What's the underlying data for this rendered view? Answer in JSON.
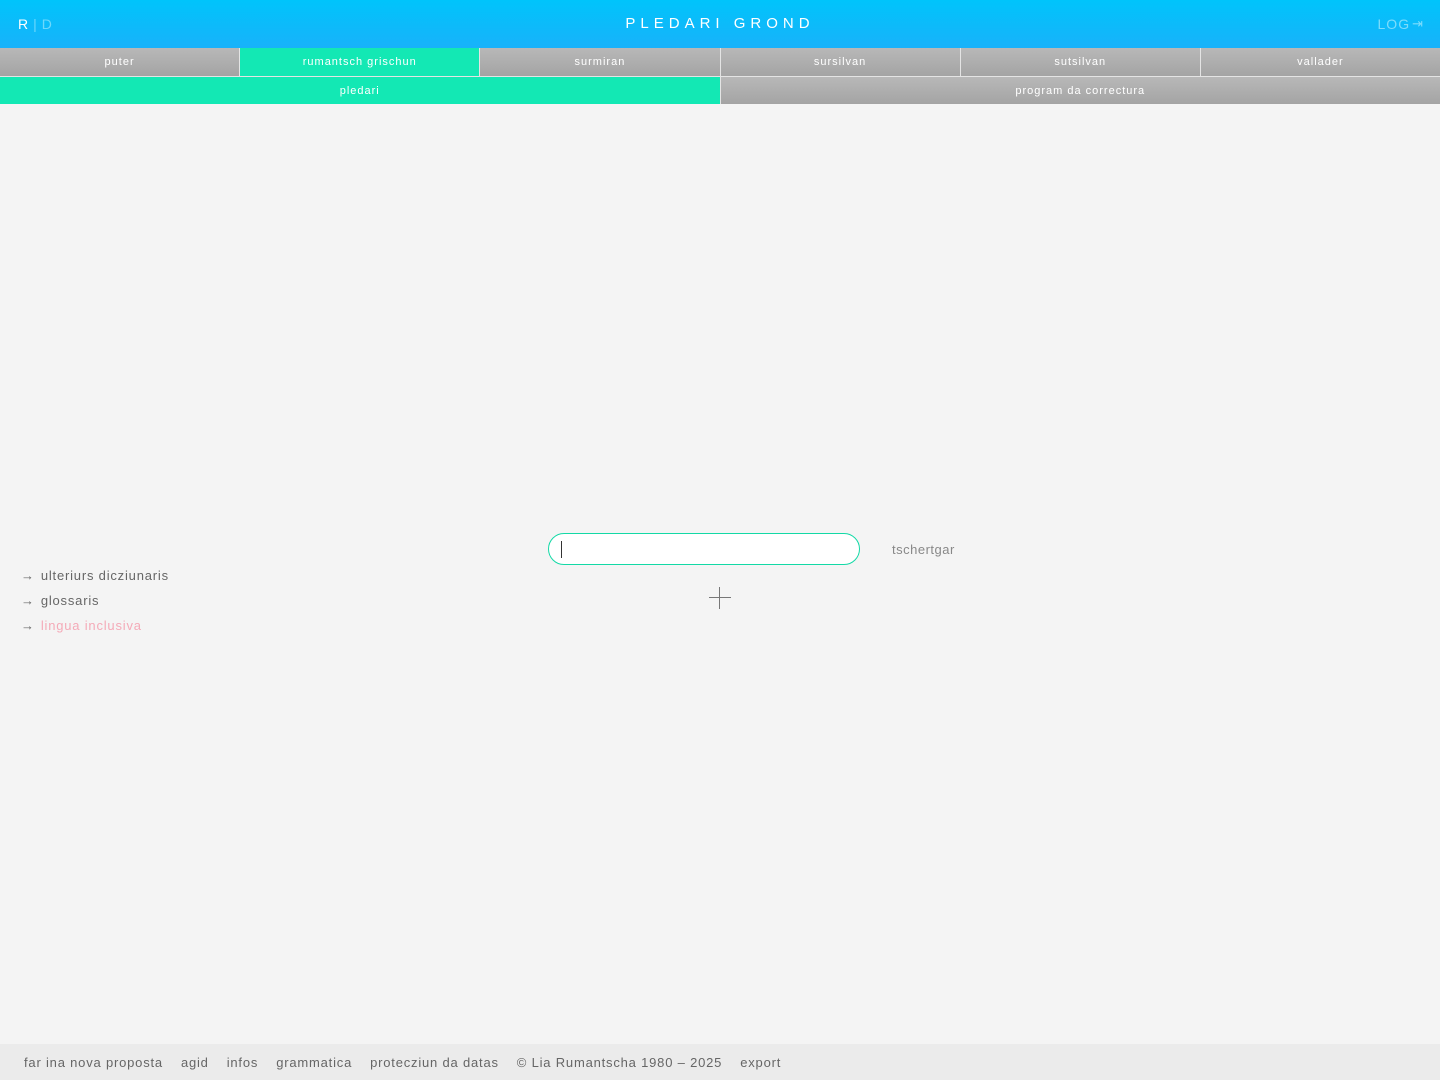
{
  "header": {
    "lang_active": "R",
    "lang_separator": "|",
    "lang_inactive": "D",
    "title": "PLEDARI GROND",
    "login_label": "LOG",
    "login_icon": "login-arrow-icon"
  },
  "tabs_row1": [
    {
      "label": "puter",
      "active": false
    },
    {
      "label": "rumantsch grischun",
      "active": true
    },
    {
      "label": "surmiran",
      "active": false
    },
    {
      "label": "sursilvan",
      "active": false
    },
    {
      "label": "sutsilvan",
      "active": false
    },
    {
      "label": "vallader",
      "active": false
    }
  ],
  "tabs_row2": [
    {
      "label": "pledari",
      "active": true
    },
    {
      "label": "program da correctura",
      "active": false
    }
  ],
  "search": {
    "value": "",
    "placeholder": "",
    "button_label": "tschertgar"
  },
  "side_links": [
    {
      "arrow": "→",
      "label": "ulteriurs dicziunaris"
    },
    {
      "arrow": "→",
      "label": "glossaris"
    },
    {
      "arrow": "→",
      "label": "lingua inclusiva"
    }
  ],
  "footer": {
    "items": [
      "far ina nova proposta",
      "agid",
      "infos",
      "grammatica",
      "protecziun da datas"
    ],
    "copyright": "© Lia Rumantscha 1980 – 2025",
    "export": "export"
  },
  "colors": {
    "header_gradient_top": "#00c4fb",
    "accent_green": "#13e8b4",
    "tab_grey": "#adadad",
    "highlight_pink": "#f4aab8",
    "background": "#f4f4f4"
  }
}
